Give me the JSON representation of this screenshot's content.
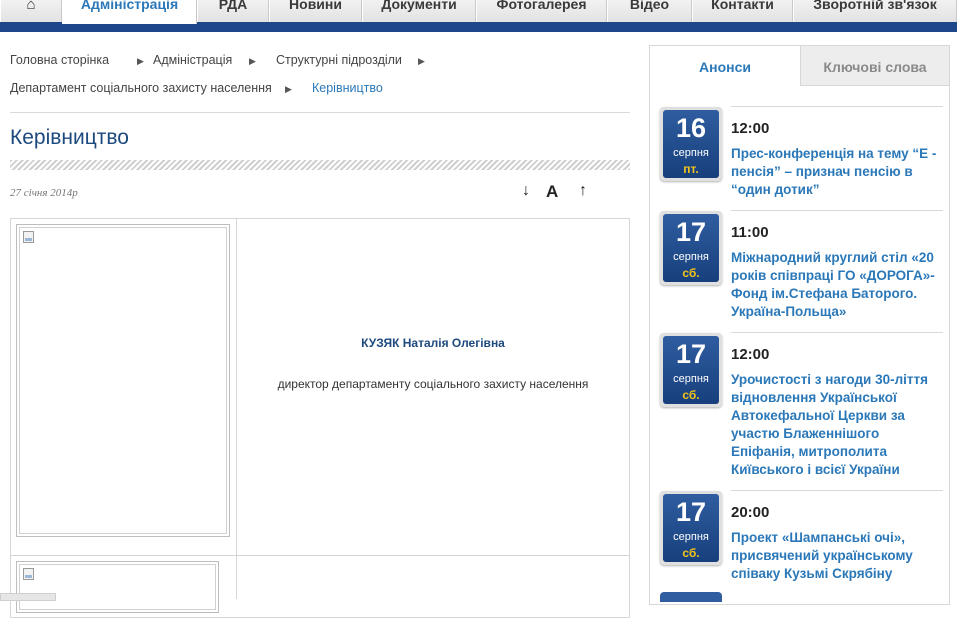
{
  "nav": {
    "items": [
      {
        "label": "⌂"
      },
      {
        "label": "Адміністрація"
      },
      {
        "label": "РДА"
      },
      {
        "label": "Новини"
      },
      {
        "label": "Документи"
      },
      {
        "label": "Фотогалерея"
      },
      {
        "label": "Відео"
      },
      {
        "label": "Контакти"
      },
      {
        "label": "Зворотній зв'язок"
      }
    ]
  },
  "breadcrumb": {
    "items": [
      "Головна сторінка",
      "Адміністрація",
      "Структурні підрозділи",
      "Департамент соціального захисту населення"
    ],
    "current": "Керівництво"
  },
  "page": {
    "title": "Керівництво",
    "date": "27 січня 2014р"
  },
  "tools": {
    "down_icon": "arrow-down-icon",
    "font_icon": "font-size-icon",
    "up_icon": "arrow-up-icon",
    "down_glyph": "↓",
    "font_glyph": "A",
    "up_glyph": "↑"
  },
  "person": {
    "name": "КУЗЯК Наталія Олегівна",
    "role": "директор департаменту соціального захисту населення"
  },
  "sidebar": {
    "tabs": [
      "Анонси",
      "Ключові слова"
    ],
    "events": [
      {
        "day": "16",
        "month": "серпня",
        "weekday": "пт.",
        "time": "12:00",
        "title": "Прес-конференція на тему “Е - пенсія” – признач пенсію в “один дотик”"
      },
      {
        "day": "17",
        "month": "серпня",
        "weekday": "сб.",
        "time": "11:00",
        "title": "Міжнародний круглий стіл «20 років співпраці ГО «ДОРОГА»-Фонд ім.Стефана Баторого. Україна-Польща»"
      },
      {
        "day": "17",
        "month": "серпня",
        "weekday": "сб.",
        "time": "12:00",
        "title": "Урочистості з нагоди 30-ліття відновлення Української Автокефальної Церкви за участю Блаженнішого Епіфанія, митрополита Київського і всієї України"
      },
      {
        "day": "17",
        "month": "серпня",
        "weekday": "сб.",
        "time": "20:00",
        "title": "Проект «Шампанські очі», присвячений українському співаку Кузьмі Скрябіну"
      }
    ]
  },
  "colors": {
    "nav_blue": "#1d4789",
    "link_blue": "#2b78b8",
    "calendar_blue": "#173f7c",
    "weekday_yellow": "#f2c31a"
  }
}
